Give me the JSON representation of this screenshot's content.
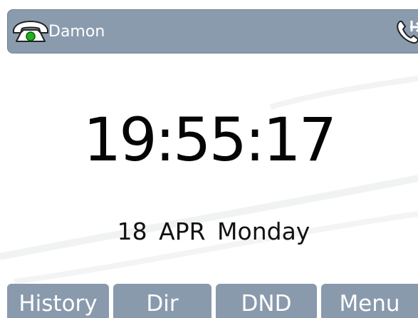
{
  "status_bar": {
    "account_name": "Damon",
    "account_icon": "phone-registered-icon",
    "right_icon": "call-forward-icon"
  },
  "clock": {
    "time": "19:55:17"
  },
  "date": {
    "text": "18  APR  Monday"
  },
  "softkeys": [
    {
      "label": "History"
    },
    {
      "label": "Dir"
    },
    {
      "label": "DND"
    },
    {
      "label": "Menu"
    }
  ],
  "colors": {
    "bar": "#8a9bae",
    "softkey": "#899aad",
    "status_dot": "#1fb21f",
    "text_dark": "#050505"
  }
}
